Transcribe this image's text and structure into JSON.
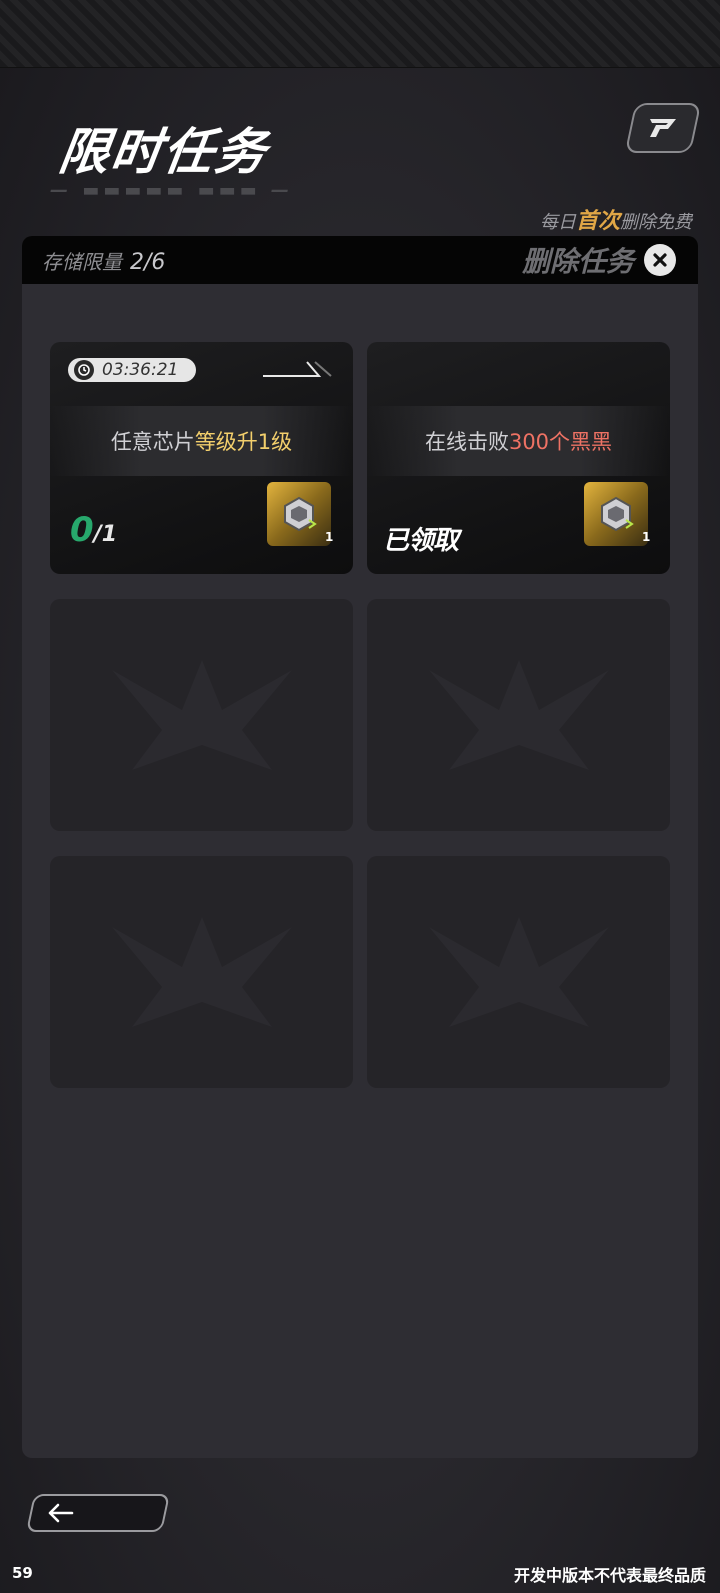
{
  "header": {
    "title": "限时任务",
    "hint_prefix": "每日",
    "hint_highlight": "首次",
    "hint_suffix": "删除免费"
  },
  "panel": {
    "storage_label": "存储限量",
    "storage_value": "2/6",
    "delete_label": "删除任务"
  },
  "tasks": [
    {
      "timer": "03:36:21",
      "desc_plain": "任意芯片",
      "desc_highlight": "等级升1级",
      "progress_current": "0",
      "progress_total": "/1",
      "reward_count": "1"
    },
    {
      "desc_plain": "在线击败",
      "desc_highlight": "300个黑黑",
      "status": "已领取",
      "reward_count": "1"
    }
  ],
  "footer": {
    "fps": "59",
    "watermark": "开发中版本不代表最终品质"
  },
  "icons": {
    "corner": "logo-icon",
    "delete": "close-icon",
    "timer": "clock-icon",
    "reward": "chip-icon",
    "back": "arrow-left-icon"
  },
  "colors": {
    "gold_highlight": "#f3cf6c",
    "red_highlight": "#ee7264",
    "progress_green": "#27a86c",
    "free_highlight": "#e0a646"
  }
}
